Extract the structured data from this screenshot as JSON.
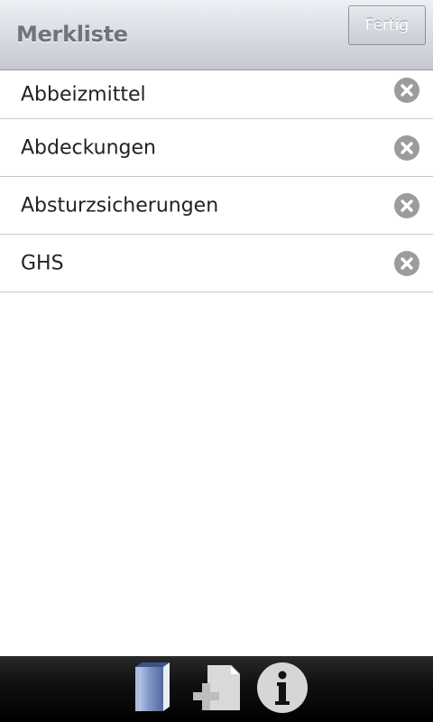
{
  "header": {
    "title": "Merkliste",
    "done_label": "Fertig"
  },
  "list": {
    "items": [
      {
        "label": "Abbeizmittel",
        "action_icon": "remove-circle-icon"
      },
      {
        "label": "Abdeckungen",
        "action_icon": "remove-circle-icon"
      },
      {
        "label": "Absturzsicherungen",
        "action_icon": "remove-circle-icon"
      },
      {
        "label": "GHS",
        "action_icon": "remove-circle-icon"
      }
    ]
  },
  "toolbar": {
    "buttons": [
      {
        "icon": "book-icon"
      },
      {
        "icon": "add-document-icon"
      },
      {
        "icon": "info-icon"
      }
    ]
  },
  "colors": {
    "header_gradient_top": "#eef0f5",
    "header_gradient_bottom": "#c5c8d1",
    "title_text": "#6f737c",
    "list_divider": "#c8c8c8",
    "remove_icon": "#9c9c9c",
    "toolbar_bg": "#000000"
  }
}
